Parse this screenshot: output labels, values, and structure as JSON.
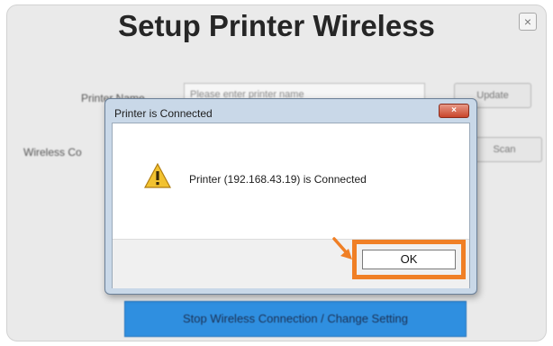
{
  "window": {
    "title": "Setup Printer Wireless",
    "close_glyph": "×"
  },
  "background_form": {
    "printer_name_label": "Printer Name",
    "printer_name_value": "Please enter printer name",
    "update_button": "Update",
    "wireless_label": "Wireless Co",
    "scan_button": "Scan",
    "stop_button": "Stop Wireless Connection / Change Setting"
  },
  "dialog": {
    "title": "Printer is Connected",
    "close_glyph": "×",
    "icon": "warning-icon",
    "message": "Printer (192.168.43.19) is Connected",
    "ok_label": "OK"
  },
  "colors": {
    "highlight": "#f07f25",
    "primary_button": "#2f8fe0",
    "dialog_frame": "#c9d8e8"
  }
}
